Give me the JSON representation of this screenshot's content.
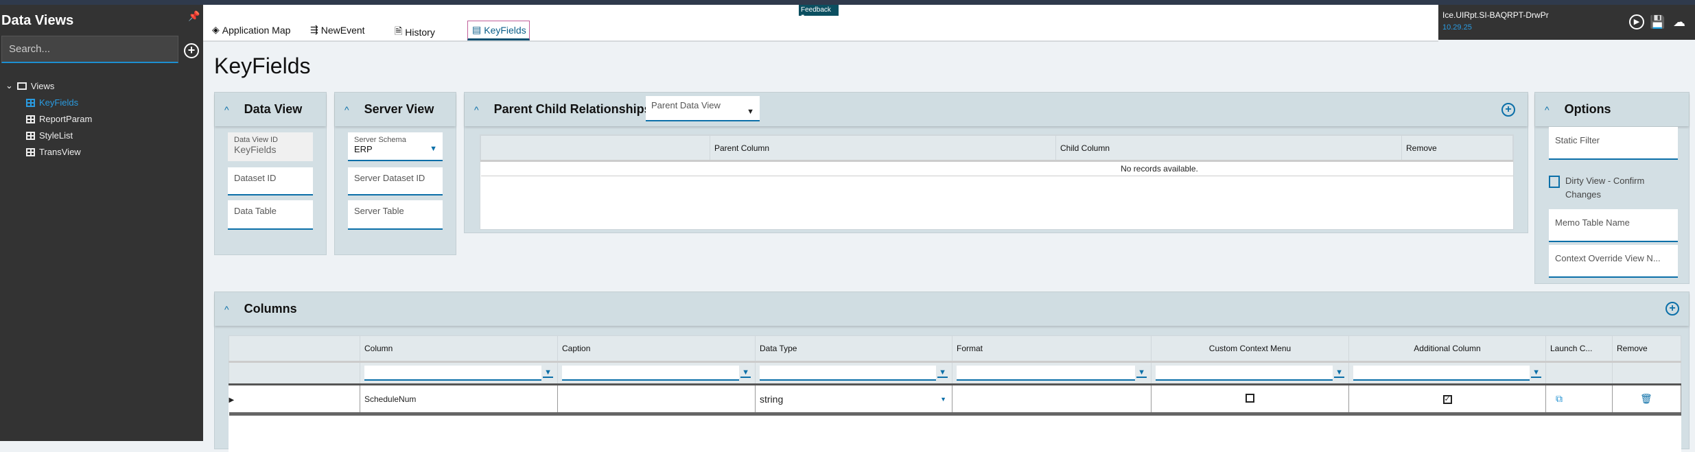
{
  "sidebar": {
    "title": "Data Views",
    "search_placeholder": "Search...",
    "tree_root": "Views",
    "items": [
      {
        "label": "KeyFields",
        "selected": true
      },
      {
        "label": "ReportParam"
      },
      {
        "label": "StyleList"
      },
      {
        "label": "TransView"
      }
    ]
  },
  "tabs": [
    {
      "label": "Application Map",
      "icon": "layers-icon"
    },
    {
      "label": "NewEvent",
      "icon": "event-icon"
    },
    {
      "label": "History",
      "icon": "history-icon"
    },
    {
      "label": "KeyFields",
      "icon": "table-icon",
      "active": true
    }
  ],
  "feedback": "Feedback",
  "app_panel": {
    "title": "Ice.UIRpt.SI-BAQRPT-DrwPr",
    "version": "10.29.25"
  },
  "page_title": "KeyFields",
  "data_view": {
    "title": "Data View",
    "id_label": "Data View ID",
    "id_value": "KeyFields",
    "dataset_id": "Dataset ID",
    "data_table": "Data Table"
  },
  "server_view": {
    "title": "Server View",
    "schema_label": "Server Schema",
    "schema_value": "ERP",
    "dataset_id": "Server Dataset ID",
    "table": "Server Table"
  },
  "parent_child": {
    "title": "Parent Child Relationships",
    "parent_data_view": "Parent Data View",
    "columns": [
      "",
      "Parent Column",
      "Child Column",
      "Remove"
    ],
    "empty": "No records available."
  },
  "options": {
    "title": "Options",
    "static_filter": "Static Filter",
    "dirty_view": "Dirty View - Confirm Changes",
    "memo_table": "Memo Table Name",
    "context_override": "Context Override View N..."
  },
  "columns_panel": {
    "title": "Columns",
    "headers": [
      "",
      "Column",
      "Caption",
      "Data Type",
      "Format",
      "Custom Context Menu",
      "Additional Column",
      "Launch C...",
      "Remove"
    ],
    "rows": [
      {
        "column": "ScheduleNum",
        "caption": "",
        "data_type": "string",
        "format": "",
        "custom_context_menu": false,
        "additional_column": true
      }
    ]
  },
  "colors": {
    "accent": "#0b6fa8",
    "sidebar": "#333333",
    "panel_header": "#d0dde2"
  }
}
